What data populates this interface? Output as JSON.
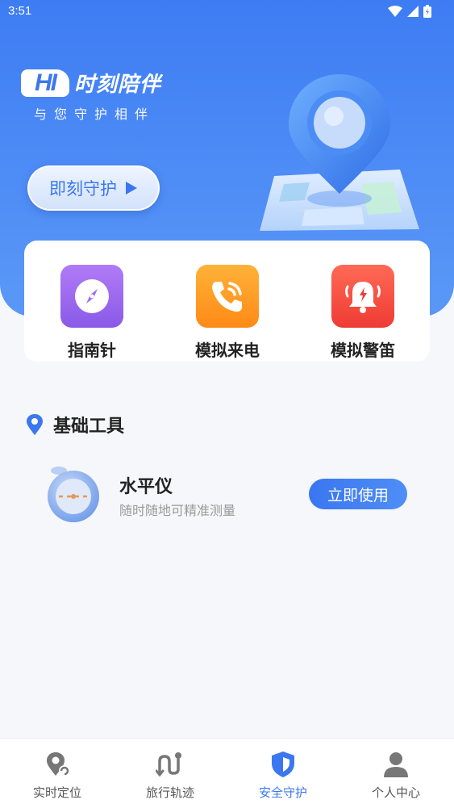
{
  "status_bar": {
    "time": "3:51"
  },
  "hero": {
    "logo_mark": "HI",
    "logo_title": "时刻陪伴",
    "slogan": "与您守护相伴",
    "guard_button": "即刻守护"
  },
  "features": [
    {
      "label": "指南针",
      "icon": "compass-icon",
      "color": "#9b6cf0"
    },
    {
      "label": "模拟来电",
      "icon": "phone-call-icon",
      "color": "#ff9a1f"
    },
    {
      "label": "模拟警笛",
      "icon": "alarm-bell-icon",
      "color": "#f5453b"
    }
  ],
  "section": {
    "title": "基础工具"
  },
  "tools": [
    {
      "name": "水平仪",
      "desc": "随时随地可精准测量",
      "button": "立即使用"
    }
  ],
  "tabs": [
    {
      "label": "实时定位",
      "icon": "location-icon",
      "active": false
    },
    {
      "label": "旅行轨迹",
      "icon": "route-icon",
      "active": false
    },
    {
      "label": "安全守护",
      "icon": "shield-icon",
      "active": true
    },
    {
      "label": "个人中心",
      "icon": "user-icon",
      "active": false
    }
  ],
  "colors": {
    "primary": "#3b78ef",
    "hero": "#4e8cf6",
    "inactive_tab": "#777777"
  }
}
